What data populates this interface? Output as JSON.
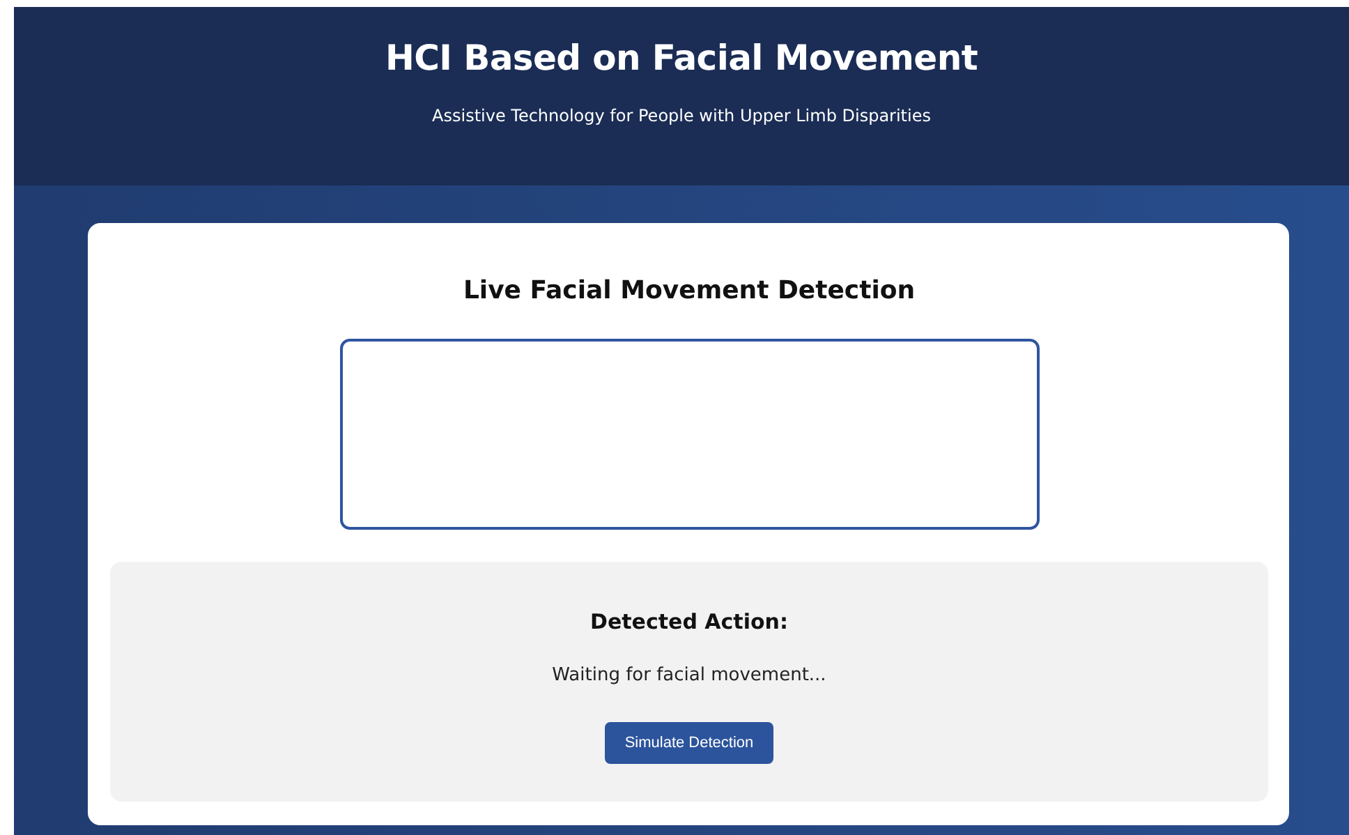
{
  "header": {
    "title": "HCI Based on Facial Movement",
    "subtitle": "Assistive Technology for People with Upper Limb Disparities"
  },
  "detection": {
    "title": "Live Facial Movement Detection",
    "result_label": "Detected Action:",
    "result_text": "Waiting for facial movement...",
    "button": "Simulate Detection"
  }
}
